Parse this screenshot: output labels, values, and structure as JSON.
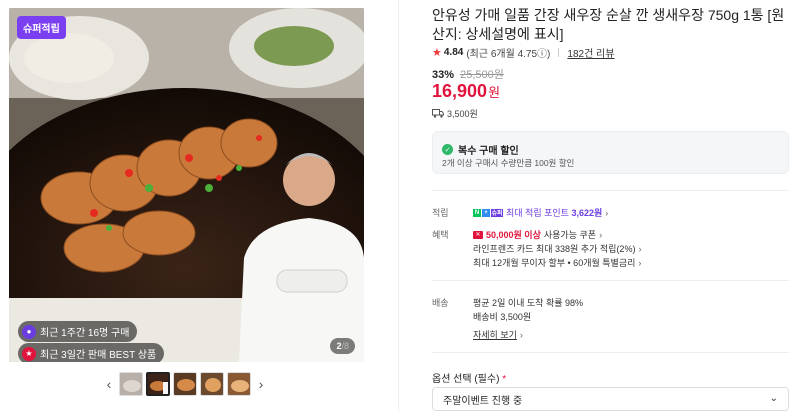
{
  "gallery": {
    "badge": "슈퍼적립",
    "pill_1": "최근 1주간 16명 구매",
    "pill_2": "최근 3일간 판매 BEST 상품",
    "counter_current": "2",
    "counter_total": "/8",
    "thumbnails": 5
  },
  "product": {
    "title": "안유성 가매 일품 간장 새우장 순살 깐 생새우장 750g 1통 [원산지: 상세설명에 표시]",
    "rating_score": "4.84",
    "rating_recent": "(최근 6개월 4.75ⓘ)",
    "review_count": "182건 리뷰",
    "discount_pct": "33%",
    "original_price": "25,500원",
    "price_num": "16,900",
    "price_unit": "원",
    "shipping_fee": "3,500원"
  },
  "multi_discount": {
    "title": "복수 구매 할인",
    "desc": "2개 이상 구매시 수량만큼 100원 할인"
  },
  "benefits": {
    "points_label": "적립",
    "points_text": "최대 적립 포인트",
    "points_value": "3,622원",
    "perks_label": "혜택",
    "coupon_bold": "50,000원 이상",
    "coupon_text": "사용가능 쿠폰",
    "card_text": "라인프렌즈 카드 최대 338원 추가 적립(2%)",
    "installment_text": "최대 12개월 무이자 할부 • 60개월 특별금리"
  },
  "delivery": {
    "label": "배송",
    "arrival": "평균 2일 이내 도착 확률 98%",
    "fee": "배송비 3,500원",
    "detail_link": "자세히 보기"
  },
  "option": {
    "label": "옵션 선택 (필수)",
    "required_mark": "*",
    "selected": "주말이벤트 진행 중"
  },
  "colors": {
    "price_red": "#e0143c",
    "accent_purple": "#6b3ce0",
    "badge_purple": "#7b3ff2",
    "star": "#f13a3a"
  }
}
